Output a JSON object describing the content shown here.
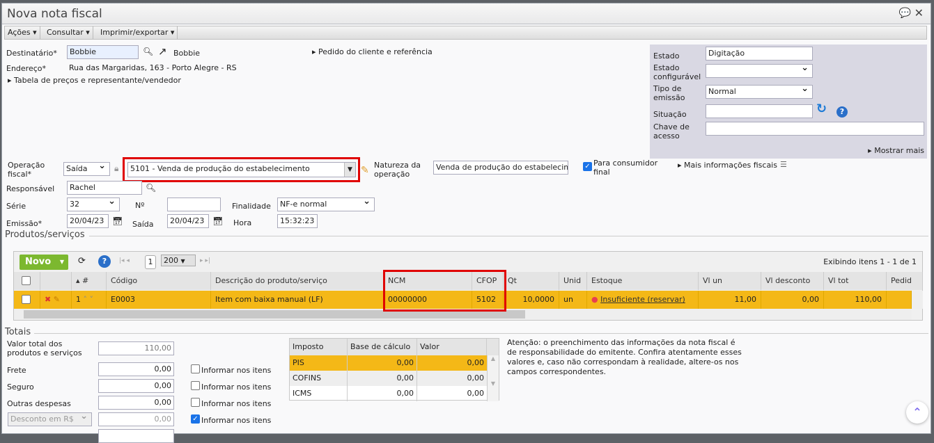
{
  "window": {
    "title": "Nova nota fiscal"
  },
  "menu": [
    "Ações",
    "Consultar",
    "Imprimir/exportar"
  ],
  "form": {
    "destinatario_label": "Destinatário*",
    "destinatario_value": "Bobbie",
    "destinatario_link": "Bobbie",
    "endereco_label": "Endereço*",
    "endereco_value": "Rua das Margaridas, 163 - Porto Alegre - RS",
    "tabela_link": "Tabela de preços e representante/vendedor",
    "pedido_link": "Pedido do cliente e referência",
    "operacao_label": "Operação fiscal*",
    "operacao_tipo": "Saída",
    "operacao_value": "5101 - Venda de produção do estabelecimento",
    "natureza_label": "Natureza da operação",
    "natureza_value": "Venda de produção do estabelecimento",
    "consumidor_label": "Para consumidor final",
    "consumidor_checked": true,
    "mais_info": "Mais informações fiscais",
    "responsavel_label": "Responsável",
    "responsavel_value": "Rachel",
    "serie_label": "Série",
    "serie_value": "32",
    "numero_label": "Nº",
    "numero_value": "",
    "finalidade_label": "Finalidade",
    "finalidade_value": "NF-e normal",
    "emissao_label": "Emissão*",
    "emissao_value": "20/04/23",
    "saida_label": "Saída",
    "saida_value": "20/04/23",
    "hora_label": "Hora",
    "hora_value": "15:32:23"
  },
  "status": {
    "estado_label": "Estado",
    "estado_value": "Digitação",
    "estado_conf_label": "Estado configurável",
    "estado_conf_value": "",
    "tipo_label": "Tipo de emissão",
    "tipo_value": "Normal",
    "situacao_label": "Situação",
    "situacao_value": "",
    "chave_label": "Chave de acesso",
    "chave_value": "",
    "mostrar_mais": "Mostrar mais"
  },
  "products": {
    "section": "Produtos/serviços",
    "novo": "Novo",
    "page": "1",
    "page_size": "200",
    "showing": "Exibindo itens 1 - 1 de 1",
    "headers": [
      "#",
      "Código",
      "Descrição do produto/serviço",
      "NCM",
      "CFOP",
      "Qt",
      "Unid",
      "Estoque",
      "Vl un",
      "Vl desconto",
      "Vl tot",
      "Pedid"
    ],
    "rows": [
      {
        "n": "1",
        "codigo": "E0003",
        "descricao": "Item com baixa manual (LF)",
        "ncm": "00000000",
        "cfop": "5102",
        "qt": "10,0000",
        "unid": "un",
        "estoque": "Insuficiente (reservar)",
        "vl_un": "11,00",
        "vl_desconto": "0,00",
        "vl_tot": "110,00",
        "pedido": ""
      }
    ]
  },
  "totais": {
    "section": "Totais",
    "valor_total_label": "Valor total dos produtos e serviços",
    "valor_total": "110,00",
    "frete_label": "Frete",
    "frete": "0,00",
    "seguro_label": "Seguro",
    "seguro": "0,00",
    "outras_label": "Outras despesas",
    "outras": "0,00",
    "desconto_select": "Desconto em R$",
    "desconto": "0,00",
    "informar": "Informar nos itens",
    "informar_checked": [
      false,
      false,
      false,
      true
    ]
  },
  "impostos": {
    "headers": [
      "Imposto",
      "Base de cálculo",
      "Valor"
    ],
    "rows": [
      [
        "PIS",
        "0,00",
        "0,00"
      ],
      [
        "COFINS",
        "0,00",
        "0,00"
      ],
      [
        "ICMS",
        "0,00",
        "0,00"
      ]
    ]
  },
  "notice": "Atenção: o preenchimento das informações da nota fiscal é de responsabilidade do emitente. Confira atentamente esses valores e, caso não correspondam à realidade, altere-os nos campos correspondentes."
}
